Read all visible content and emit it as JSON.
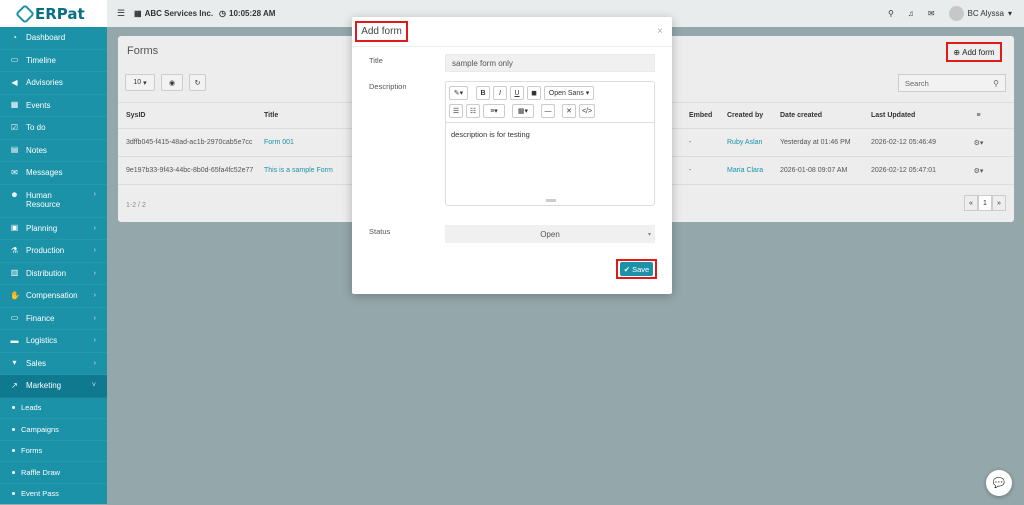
{
  "app": {
    "logo_text": "ERPat"
  },
  "sidebar": {
    "items": [
      {
        "label": "Dashboard",
        "icon": "dashboard-icon",
        "glyph": "◔"
      },
      {
        "label": "Timeline",
        "icon": "timeline-icon",
        "glyph": "▭"
      },
      {
        "label": "Advisories",
        "icon": "megaphone-icon",
        "glyph": "◀"
      },
      {
        "label": "Events",
        "icon": "calendar-icon",
        "glyph": "▦"
      },
      {
        "label": "To do",
        "icon": "checkbox-icon",
        "glyph": "☑"
      },
      {
        "label": "Notes",
        "icon": "note-icon",
        "glyph": "▤"
      },
      {
        "label": "Messages",
        "icon": "envelope-icon",
        "glyph": "✉"
      },
      {
        "label": "Human Resource",
        "icon": "users-icon",
        "glyph": "☻"
      },
      {
        "label": "Planning",
        "icon": "layers-icon",
        "glyph": "▣"
      },
      {
        "label": "Production",
        "icon": "flask-icon",
        "glyph": "⚗"
      },
      {
        "label": "Distribution",
        "icon": "bank-icon",
        "glyph": "▥"
      },
      {
        "label": "Compensation",
        "icon": "hand-money-icon",
        "glyph": "✋"
      },
      {
        "label": "Finance",
        "icon": "money-icon",
        "glyph": "▭"
      },
      {
        "label": "Logistics",
        "icon": "truck-icon",
        "glyph": "▬"
      },
      {
        "label": "Sales",
        "icon": "cart-icon",
        "glyph": "▾"
      },
      {
        "label": "Marketing",
        "icon": "chart-line-icon",
        "glyph": "↗"
      }
    ],
    "sub_items": [
      "Leads",
      "Campaigns",
      "Forms",
      "Raffle Draw",
      "Event Pass"
    ]
  },
  "topbar": {
    "company": "ABC Services Inc.",
    "time": "10:05:28 AM",
    "user": "BC Alyssa"
  },
  "page": {
    "title": "Forms",
    "add_button": "Add form",
    "page_size": "10",
    "search_placeholder": "Search",
    "columns": [
      "SysID",
      "Title",
      "Embed",
      "Created by",
      "Date created",
      "Last Updated"
    ],
    "rows": [
      {
        "sysid": "3dffb045-f415-48ad-ac1b-2970cab5e7cc",
        "title": "Form 001",
        "embed": "-",
        "created_by": "Ruby Aslan",
        "date_created": "Yesterday at 01:46 PM",
        "last_updated": "2026-02-12 05:46:49"
      },
      {
        "sysid": "9e197b33-9f43-44bc-8b0d-65fa4fc52e77",
        "title": "This is a sample Form",
        "embed": "-",
        "created_by": "Maria Clara",
        "date_created": "2026-01-08 09:07 AM",
        "last_updated": "2026-02-12 05:47:01"
      }
    ],
    "pager_info": "1-2 / 2",
    "current_page": "1"
  },
  "modal": {
    "title": "Add form",
    "title_label": "Title",
    "title_value": "sample form only",
    "description_label": "Description",
    "font_name": "Open Sans",
    "description_value": "description is for testing",
    "status_label": "Status",
    "status_value": "Open",
    "save_label": "Save"
  }
}
